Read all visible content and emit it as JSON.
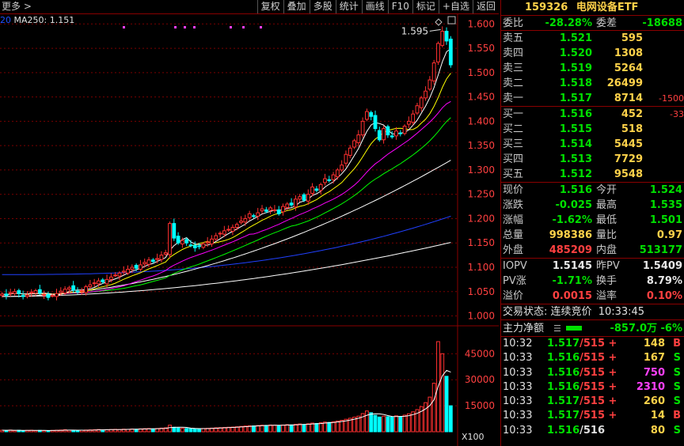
{
  "toolbar": {
    "more_label": "更多 >",
    "buttons": [
      "复权",
      "叠加",
      "多股",
      "统计",
      "画线",
      "F10",
      "标记",
      "+自选",
      "返回"
    ]
  },
  "chart": {
    "ma_legend_prefix": "20",
    "ma_legend": "MA250: 1.151",
    "price_axis": [
      "1.600",
      "1.550",
      "1.500",
      "1.450",
      "1.400",
      "1.350",
      "1.300",
      "1.250",
      "1.200",
      "1.150",
      "1.100",
      "1.050",
      "1.000"
    ],
    "high_annotation": "1.595",
    "volume_axis": [
      "45000",
      "30000",
      "15000"
    ],
    "volume_unit": "X100",
    "colors": {
      "up": "#ff3030",
      "down": "#00ffff",
      "ma5": "#ffffff",
      "ma10": "#ffff00",
      "ma20": "#ff00ff",
      "ma30": "#00ff00",
      "ma60": "#ffffff",
      "ma120": "#2040ff",
      "ma250": "#ffffff",
      "grid": "#7a0000"
    }
  },
  "chart_data": {
    "type": "candlestick",
    "price_range": [
      0.97,
      1.62
    ],
    "volume_range": [
      0,
      52000
    ],
    "high": 1.595,
    "ma250_last": 1.151,
    "closes": [
      1.045,
      1.042,
      1.048,
      1.05,
      1.046,
      1.04,
      1.043,
      1.049,
      1.052,
      1.047,
      1.044,
      1.038,
      1.042,
      1.046,
      1.051,
      1.055,
      1.058,
      1.053,
      1.049,
      1.052,
      1.06,
      1.064,
      1.068,
      1.072,
      1.07,
      1.075,
      1.08,
      1.084,
      1.088,
      1.092,
      1.096,
      1.1,
      1.098,
      1.105,
      1.11,
      1.115,
      1.112,
      1.118,
      1.125,
      1.13,
      1.19,
      1.16,
      1.15,
      1.155,
      1.15,
      1.145,
      1.14,
      1.143,
      1.148,
      1.152,
      1.158,
      1.165,
      1.17,
      1.175,
      1.178,
      1.182,
      1.188,
      1.195,
      1.2,
      1.21,
      1.205,
      1.212,
      1.22,
      1.215,
      1.222,
      1.218,
      1.21,
      1.225,
      1.23,
      1.228,
      1.24,
      1.245,
      1.238,
      1.25,
      1.265,
      1.258,
      1.27,
      1.282,
      1.278,
      1.29,
      1.3,
      1.31,
      1.332,
      1.345,
      1.36,
      1.372,
      1.4,
      1.42,
      1.41,
      1.385,
      1.362,
      1.385,
      1.372,
      1.368,
      1.38,
      1.375,
      1.39,
      1.4,
      1.415,
      1.432,
      1.448,
      1.462,
      1.485,
      1.52,
      1.56,
      1.585,
      1.565,
      1.516
    ],
    "volumes": [
      900,
      800,
      1000,
      700,
      900,
      600,
      800,
      900,
      700,
      800,
      700,
      600,
      800,
      900,
      1000,
      1200,
      900,
      800,
      700,
      900,
      1000,
      1100,
      1200,
      1300,
      1100,
      1200,
      1300,
      1400,
      1300,
      1500,
      1400,
      1600,
      1500,
      1700,
      1800,
      1900,
      1700,
      1900,
      2100,
      2300,
      3800,
      2600,
      2200,
      2000,
      1900,
      1800,
      1700,
      1800,
      1900,
      2000,
      2100,
      2300,
      2400,
      2500,
      2600,
      2700,
      2900,
      3100,
      3300,
      3500,
      3400,
      3600,
      3800,
      3700,
      3900,
      3800,
      3600,
      3900,
      4100,
      4000,
      4300,
      4500,
      4200,
      4600,
      5000,
      4800,
      5200,
      5600,
      5400,
      5800,
      6200,
      6600,
      7200,
      7800,
      8400,
      9000,
      10500,
      12000,
      11000,
      9500,
      8500,
      9000,
      8700,
      8500,
      9200,
      8800,
      9600,
      10400,
      11500,
      12800,
      14500,
      16800,
      20000,
      28000,
      52000,
      45000,
      32000,
      15000
    ]
  },
  "quote": {
    "code": "159326",
    "name": "电网设备ETF",
    "weibi_label": "委比",
    "weibi": "-28.28%",
    "weicha_label": "委差",
    "weicha": "-18688",
    "asks": [
      {
        "label": "卖五",
        "price": "1.521",
        "vol": "595",
        "chg": ""
      },
      {
        "label": "卖四",
        "price": "1.520",
        "vol": "1308",
        "chg": ""
      },
      {
        "label": "卖三",
        "price": "1.519",
        "vol": "5264",
        "chg": ""
      },
      {
        "label": "卖二",
        "price": "1.518",
        "vol": "26499",
        "chg": ""
      },
      {
        "label": "卖一",
        "price": "1.517",
        "vol": "8714",
        "chg": "-1500"
      }
    ],
    "bids": [
      {
        "label": "买一",
        "price": "1.516",
        "vol": "452",
        "chg": "-33"
      },
      {
        "label": "买二",
        "price": "1.515",
        "vol": "518",
        "chg": ""
      },
      {
        "label": "买三",
        "price": "1.514",
        "vol": "5445",
        "chg": ""
      },
      {
        "label": "买四",
        "price": "1.513",
        "vol": "7729",
        "chg": ""
      },
      {
        "label": "买五",
        "price": "1.512",
        "vol": "9548",
        "chg": ""
      }
    ],
    "stats": [
      {
        "l1": "现价",
        "v1": "1.516",
        "c1": "green",
        "l2": "今开",
        "v2": "1.524",
        "c2": "green"
      },
      {
        "l1": "涨跌",
        "v1": "-0.025",
        "c1": "green",
        "l2": "最高",
        "v2": "1.535",
        "c2": "green"
      },
      {
        "l1": "涨幅",
        "v1": "-1.62%",
        "c1": "green",
        "l2": "最低",
        "v2": "1.501",
        "c2": "green"
      },
      {
        "l1": "总量",
        "v1": "998386",
        "c1": "yellow",
        "l2": "量比",
        "v2": "0.97",
        "c2": "yellow"
      },
      {
        "l1": "外盘",
        "v1": "485209",
        "c1": "red",
        "l2": "内盘",
        "v2": "513177",
        "c2": "green"
      }
    ],
    "iopv": [
      {
        "l1": "IOPV",
        "v1": "1.5145",
        "c1": "white",
        "l2": "昨PV",
        "v2": "1.5409",
        "c2": "white"
      },
      {
        "l1": "PV涨",
        "v1": "-1.71%",
        "c1": "green",
        "l2": "换手",
        "v2": "8.79%",
        "c2": "white"
      },
      {
        "l1": "溢价",
        "v1": "0.0015",
        "c1": "red",
        "l2": "溢率",
        "v2": "0.10%",
        "c2": "red"
      }
    ],
    "status_label": "交易状态:",
    "status": "连续竞价",
    "status_time": "10:33:45",
    "flow_label": "主力净额",
    "flow_value": "-857.0万",
    "flow_pct": "-6%",
    "ticks": [
      {
        "time": "10:32",
        "price": "1.517",
        "amt": "/515 +",
        "vol": "148",
        "vc": "yellow",
        "side": "B",
        "sc": "red"
      },
      {
        "time": "10:33",
        "price": "1.516",
        "amt": "/515 +",
        "vol": "167",
        "vc": "yellow",
        "side": "S",
        "sc": "green"
      },
      {
        "time": "10:33",
        "price": "1.516",
        "amt": "/515 +",
        "vol": "750",
        "vc": "magenta",
        "side": "S",
        "sc": "green"
      },
      {
        "time": "10:33",
        "price": "1.516",
        "amt": "/515 +",
        "vol": "2310",
        "vc": "magenta",
        "side": "S",
        "sc": "green"
      },
      {
        "time": "10:33",
        "price": "1.517",
        "amt": "/515 +",
        "vol": "260",
        "vc": "yellow",
        "side": "S",
        "sc": "green"
      },
      {
        "time": "10:33",
        "price": "1.517",
        "amt": "/515 +",
        "vol": "14",
        "vc": "yellow",
        "side": "B",
        "sc": "red"
      },
      {
        "time": "10:33",
        "price": "1.516",
        "amt": "/516",
        "vol": "80",
        "vc": "yellow",
        "side": "S",
        "sc": "green"
      }
    ]
  }
}
